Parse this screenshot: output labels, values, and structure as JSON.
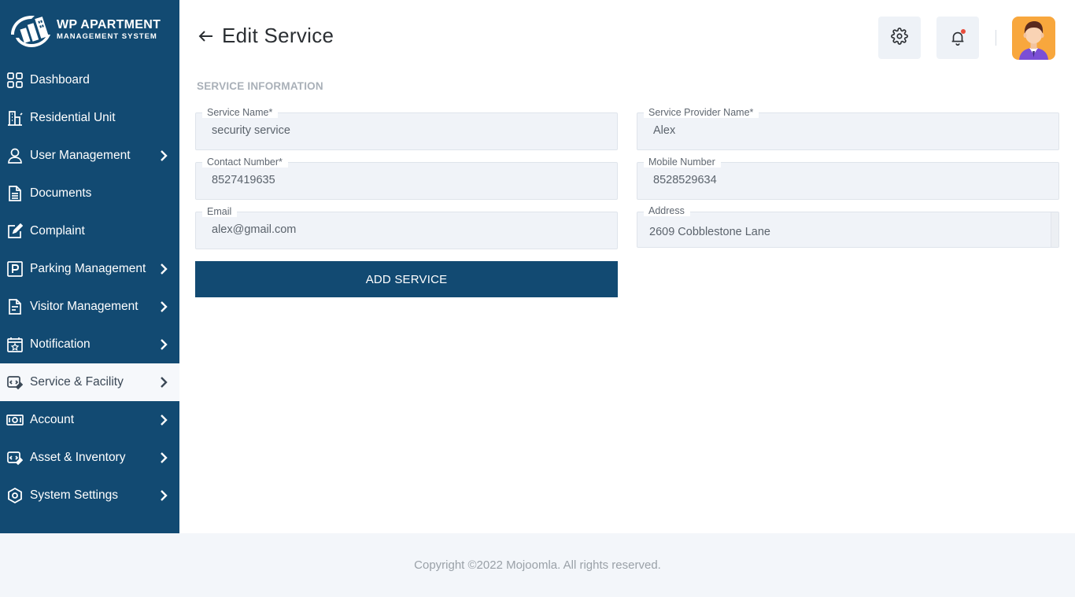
{
  "brand": {
    "title": "WP APARTMENT",
    "subtitle": "MANAGEMENT SYSTEM"
  },
  "sidebar": {
    "items": [
      {
        "label": "Dashboard",
        "icon": "dashboard-grid-icon",
        "chevron": false
      },
      {
        "label": "Residential Unit",
        "icon": "building-icon",
        "chevron": false
      },
      {
        "label": "User Management",
        "icon": "user-icon",
        "chevron": true
      },
      {
        "label": "Documents",
        "icon": "document-icon",
        "chevron": false
      },
      {
        "label": "Complaint",
        "icon": "edit-icon",
        "chevron": false
      },
      {
        "label": "Parking Management",
        "icon": "parking-icon",
        "chevron": true
      },
      {
        "label": "Visitor Management",
        "icon": "visitor-file-icon",
        "chevron": true
      },
      {
        "label": "Notification",
        "icon": "calendar-star-icon",
        "chevron": true
      },
      {
        "label": "Service & Facility",
        "icon": "service-icon",
        "chevron": true,
        "active": true
      },
      {
        "label": "Account",
        "icon": "money-icon",
        "chevron": true
      },
      {
        "label": "Asset & Inventory",
        "icon": "asset-icon",
        "chevron": true
      },
      {
        "label": "System Settings",
        "icon": "settings-eye-icon",
        "chevron": true
      }
    ]
  },
  "header": {
    "title": "Edit Service"
  },
  "section": {
    "title": "SERVICE INFORMATION"
  },
  "form": {
    "service_name": {
      "label": "Service Name*",
      "value": "security service"
    },
    "provider_name": {
      "label": "Service Provider Name*",
      "value": "Alex"
    },
    "contact_number": {
      "label": "Contact Number*",
      "value": "8527419635"
    },
    "mobile_number": {
      "label": "Mobile Number",
      "value": "8528529634"
    },
    "email": {
      "label": "Email",
      "value": "alex@gmail.com"
    },
    "address": {
      "label": "Address",
      "value": "2609 Cobblestone Lane"
    },
    "submit_label": "ADD SERVICE"
  },
  "footer": {
    "text": "Copyright ©2022 Mojoomla. All rights reserved."
  },
  "colors": {
    "primary": "#124a72",
    "field_bg": "#f0f3f8",
    "avatar_bg": "#f8a73d",
    "notification_dot": "#e74c3c"
  }
}
